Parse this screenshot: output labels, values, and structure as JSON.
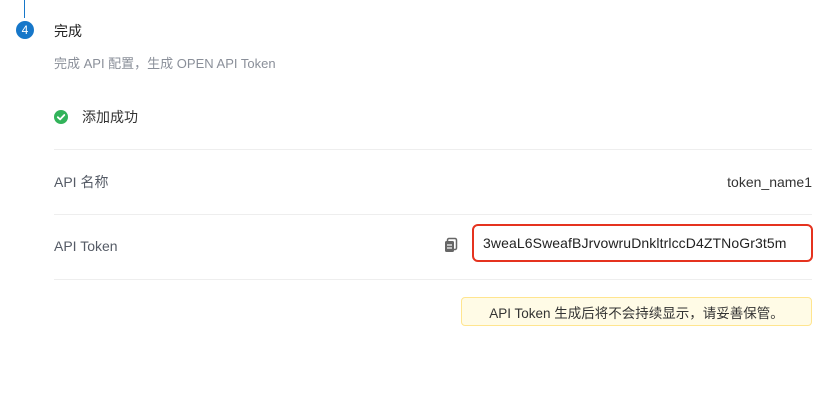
{
  "step": {
    "number": "4",
    "title": "完成",
    "description": "完成 API 配置，生成 OPEN API Token"
  },
  "result": {
    "message": "添加成功",
    "status_color": "#32b35a",
    "icon": "check-circle-icon"
  },
  "fields": {
    "name_label": "API 名称",
    "name_value": "token_name1",
    "token_label": "API Token",
    "token_value": "3weaL6SweafBJrvowruDnkltrlccD4ZTNoGr3t5m",
    "copy_icon": "copy-icon"
  },
  "notice": {
    "text": "API Token 生成后将不会持续显示，请妥善保管。"
  },
  "colors": {
    "accent": "#1677c9",
    "highlight_border": "#e5331f",
    "notice_bg": "#fffbe6",
    "notice_border": "#ffe58f"
  }
}
